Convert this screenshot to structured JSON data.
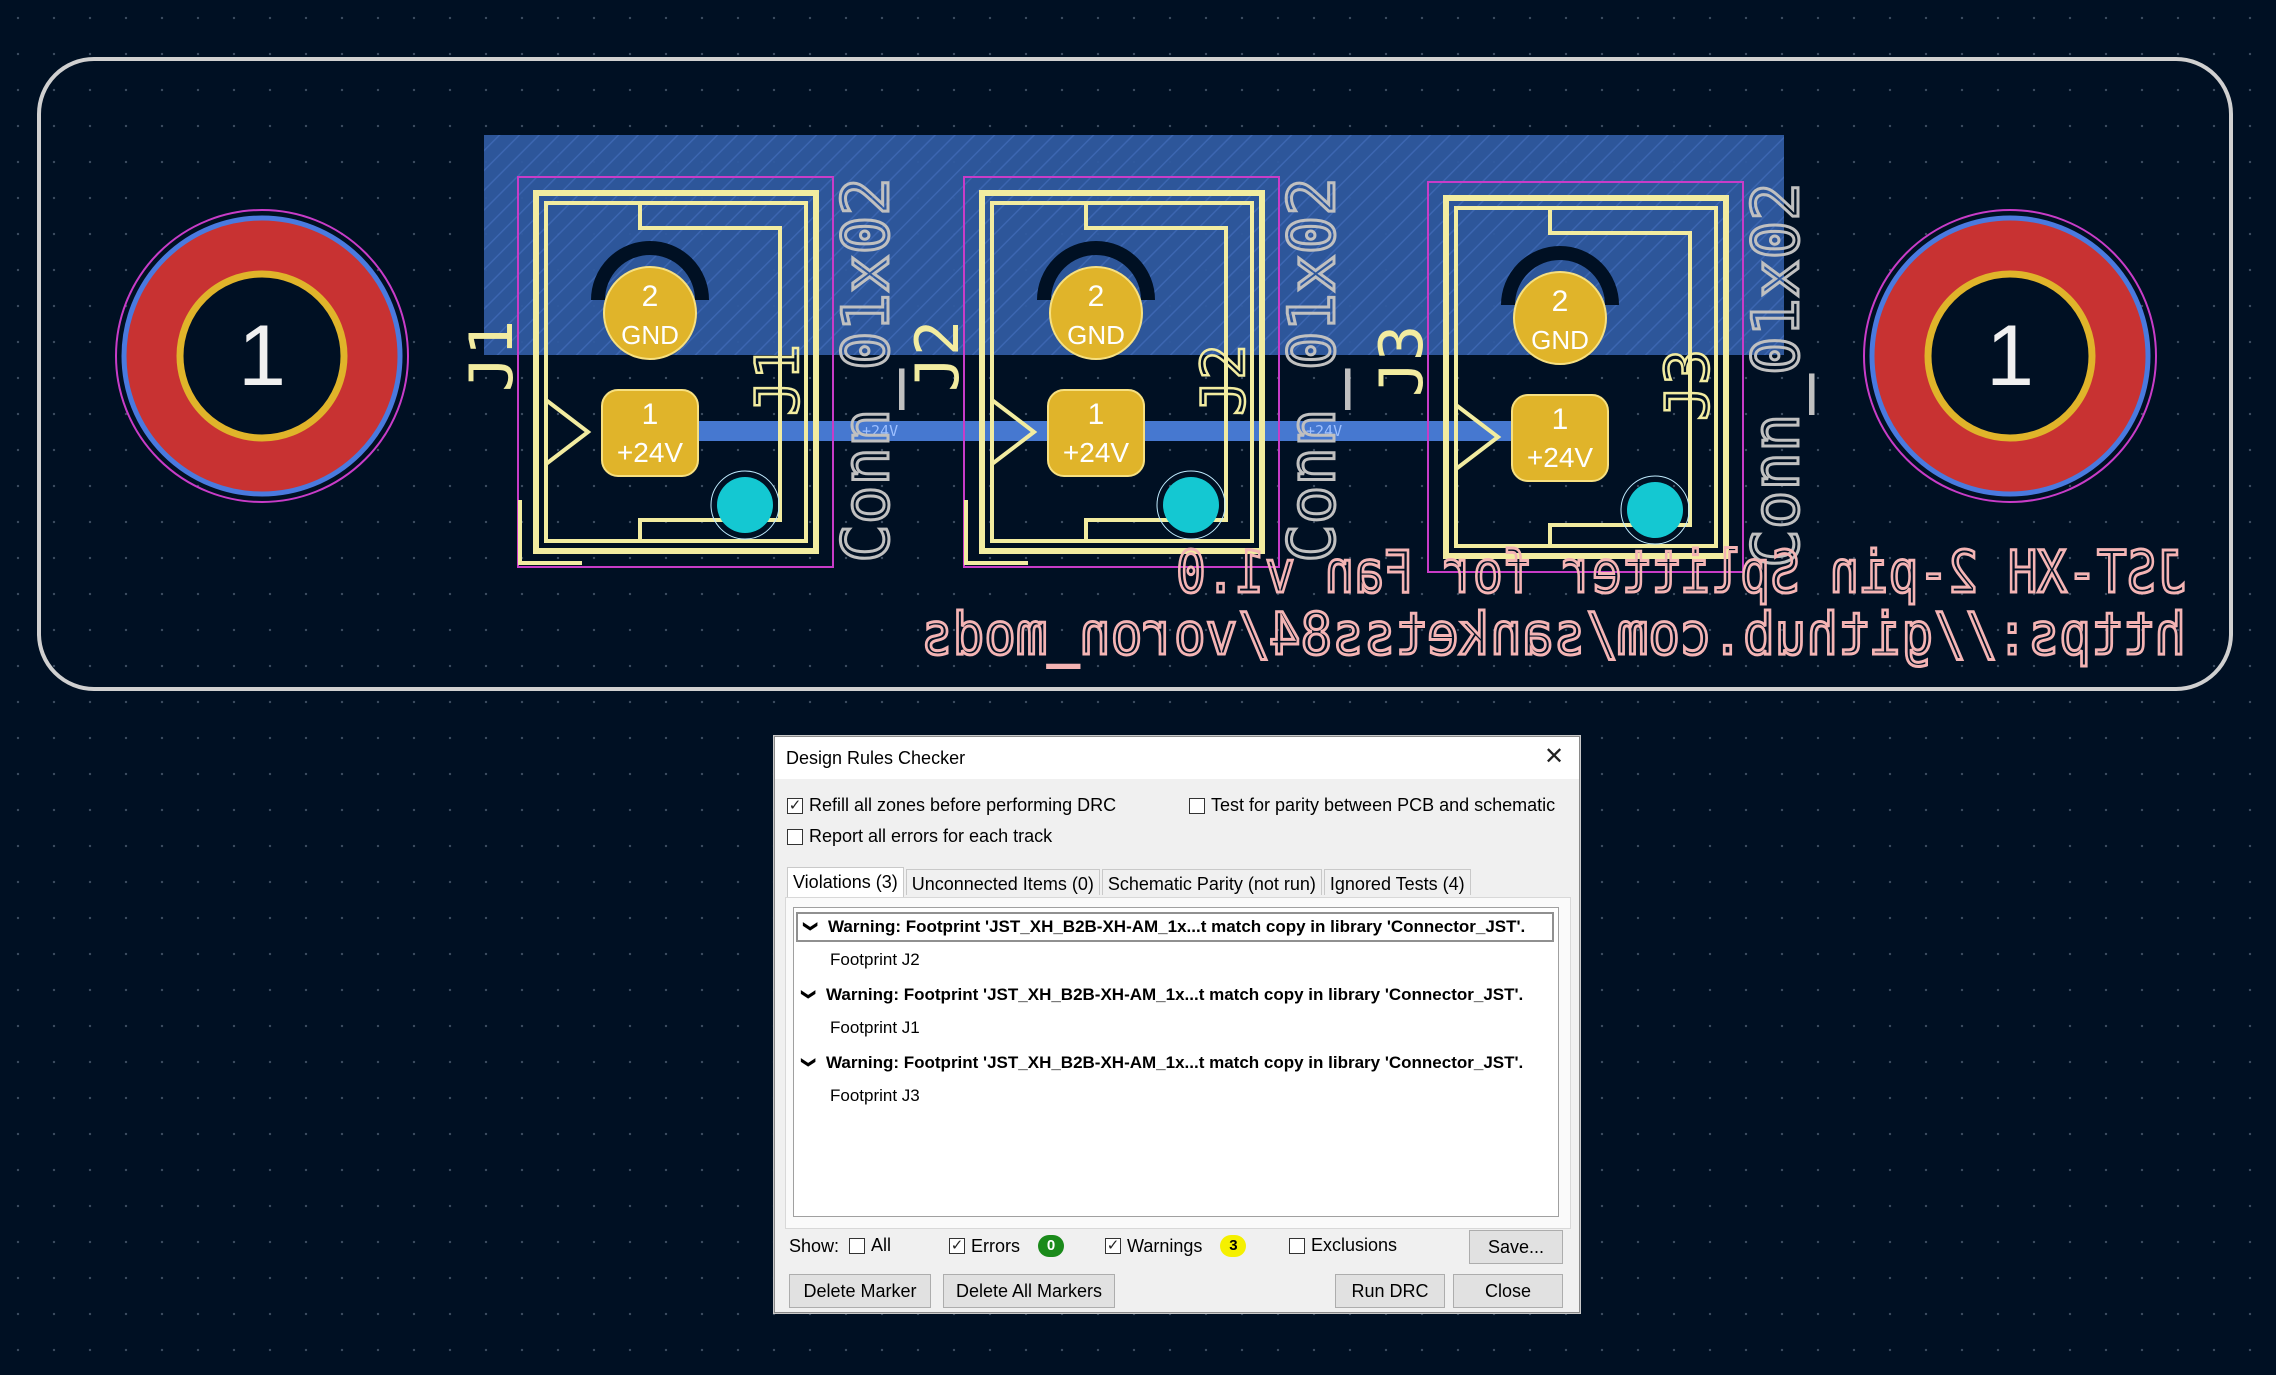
{
  "colors": {
    "background": "#001023",
    "board_outline": "#d0d0d0",
    "copper_pad": "#e0b42a",
    "mount_red": "#c83232",
    "silk_yellow": "#f2eca0",
    "silk_pink": "#f4b4b4",
    "zone_blue": "#2f5aa0",
    "track_blue": "#4678d0",
    "via_cyan": "#14c8d2",
    "courtyard_magenta": "#c83cc8"
  },
  "pcb": {
    "mount_holes": [
      {
        "label": "1"
      },
      {
        "label": "1"
      }
    ],
    "connectors": [
      {
        "ref": "J1",
        "value": "Conn_01x02",
        "pad2_num": "2",
        "pad2_net": "GND",
        "pad1_num": "1",
        "pad1_net": "+24V"
      },
      {
        "ref": "J2",
        "value": "Conn_01x02",
        "pad2_num": "2",
        "pad2_net": "GND",
        "pad1_num": "1",
        "pad1_net": "+24V"
      },
      {
        "ref": "J3",
        "value": "Conn_01x02",
        "pad2_num": "2",
        "pad2_net": "GND",
        "pad1_num": "1",
        "pad1_net": "+24V"
      }
    ],
    "track_net_labels": [
      "+24V",
      "+24V"
    ],
    "silk_text_line1": "JST-XH 2-pin Splitter for Fan v1.0",
    "silk_text_line2": "https://github.com/sanketss84/voron_mods"
  },
  "dialog": {
    "title": "Design Rules Checker",
    "close_glyph": "✕",
    "options": {
      "refill_zones": {
        "label": "Refill all zones before performing DRC",
        "checked": true
      },
      "report_all_errors": {
        "label": "Report all errors for each track",
        "checked": false
      },
      "test_parity": {
        "label": "Test for parity between PCB and schematic",
        "checked": false
      }
    },
    "tabs": [
      {
        "label": "Violations (3)",
        "active": true
      },
      {
        "label": "Unconnected Items (0)",
        "active": false
      },
      {
        "label": "Schematic Parity (not run)",
        "active": false
      },
      {
        "label": "Ignored Tests (4)",
        "active": false
      }
    ],
    "violations": [
      {
        "title": "Warning: Footprint 'JST_XH_B2B-XH-AM_1x...t match copy in library 'Connector_JST'.",
        "detail": "Footprint J2",
        "selected": true
      },
      {
        "title": "Warning: Footprint 'JST_XH_B2B-XH-AM_1x...t match copy in library 'Connector_JST'.",
        "detail": "Footprint J1",
        "selected": false
      },
      {
        "title": "Warning: Footprint 'JST_XH_B2B-XH-AM_1x...t match copy in library 'Connector_JST'.",
        "detail": "Footprint J3",
        "selected": false
      }
    ],
    "show": {
      "label": "Show:",
      "all": {
        "label": "All",
        "checked": false
      },
      "errors": {
        "label": "Errors",
        "checked": true,
        "count": "0",
        "color": "#1a8a1a"
      },
      "warnings": {
        "label": "Warnings",
        "checked": true,
        "count": "3",
        "color": "#f5f000"
      },
      "exclusions": {
        "label": "Exclusions",
        "checked": false
      }
    },
    "buttons": {
      "save": "Save...",
      "delete_marker": "Delete Marker",
      "delete_all_markers": "Delete All Markers",
      "run_drc": "Run DRC",
      "close": "Close"
    }
  }
}
